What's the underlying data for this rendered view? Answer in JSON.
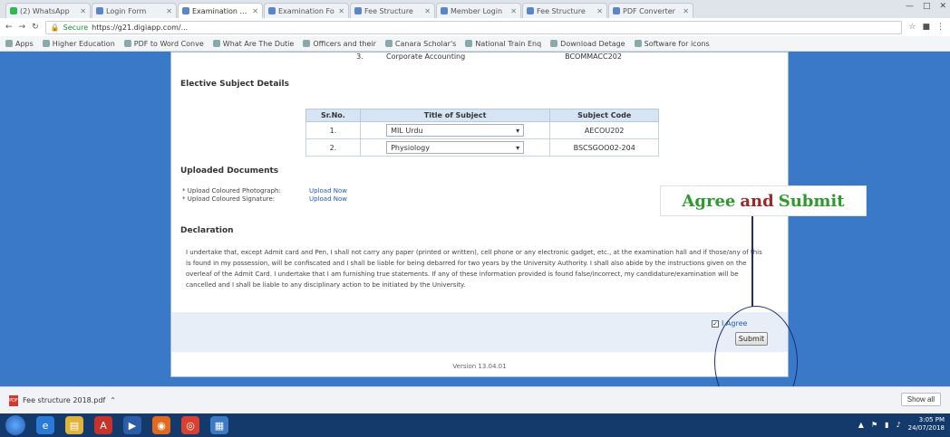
{
  "browser": {
    "tabs": [
      {
        "title": "(2) WhatsApp",
        "color": "#2dbb4d",
        "active": false
      },
      {
        "title": "Login Form",
        "color": "#5a86c9",
        "active": false
      },
      {
        "title": "Examination For",
        "color": "#5a86c9",
        "active": true
      },
      {
        "title": "Examination Fo",
        "color": "#5a86c9",
        "active": false
      },
      {
        "title": "Fee Structure",
        "color": "#5a86c9",
        "active": false
      },
      {
        "title": "Member Login",
        "color": "#5a86c9",
        "active": false
      },
      {
        "title": "Fee Structure",
        "color": "#5a86c9",
        "active": false
      },
      {
        "title": "PDF Converter",
        "color": "#5a86c9",
        "active": false
      }
    ],
    "address": {
      "secure_label": "Secure",
      "url": "https://g21.digiapp.com/..."
    },
    "bookmarks": [
      "Apps",
      "Higher Education",
      "PDF to Word Conve",
      "What Are The Dutie",
      "Officers and their",
      "Canara Scholar's",
      "National Train Enq",
      "Download Detage",
      "Software for icons"
    ]
  },
  "page": {
    "core_row": {
      "sr": "3.",
      "title": "Corporate Accounting",
      "code": "BCOMMACC202"
    },
    "elective_heading": "Elective Subject Details",
    "elective_table": {
      "headers": [
        "Sr.No.",
        "Title of Subject",
        "Subject Code"
      ],
      "rows": [
        {
          "sr": "1.",
          "subject": "MIL Urdu",
          "code": "AECOU202"
        },
        {
          "sr": "2.",
          "subject": "Physiology",
          "code": "BSCSGOO02-204"
        }
      ]
    },
    "documents_heading": "Uploaded Documents",
    "documents": [
      {
        "label": "* Upload Coloured Photograph:",
        "link": "Upload Now"
      },
      {
        "label": "* Upload Coloured Signature:",
        "link": "Upload Now"
      }
    ],
    "declaration_heading": "Declaration",
    "declaration_text": "I undertake that, except Admit card and Pen, I shall not carry any paper (printed or written), cell phone or any electronic gadget, etc., at the examination hall and if those/any of this is found in my possession, will be confiscated and I shall be liable for being debarred for two years by the University Authority. I shall also abide by the instructions given on the overleaf of the Admit Card. I undertake that I am furnishing true statements. If any of these information provided is found false/incorrect, my candidature/examination will be cancelled and I shall be liable to any disciplinary action to be initiated by the University.",
    "agree_label": "I Agree",
    "submit_label": "Submit",
    "version": "Version 13.04.01"
  },
  "annotation": {
    "word1": "Agree",
    "word2": "and",
    "word3": "Submit",
    "colors": {
      "green": "#2d9a2d",
      "and": "#9a2a2a",
      "line": "#1c2d7a"
    }
  },
  "downloads": {
    "file_name": "Fee structure 2018.pdf",
    "show_all": "Show all"
  },
  "taskbar": {
    "time": "3:05 PM",
    "date": "24/07/2018"
  }
}
